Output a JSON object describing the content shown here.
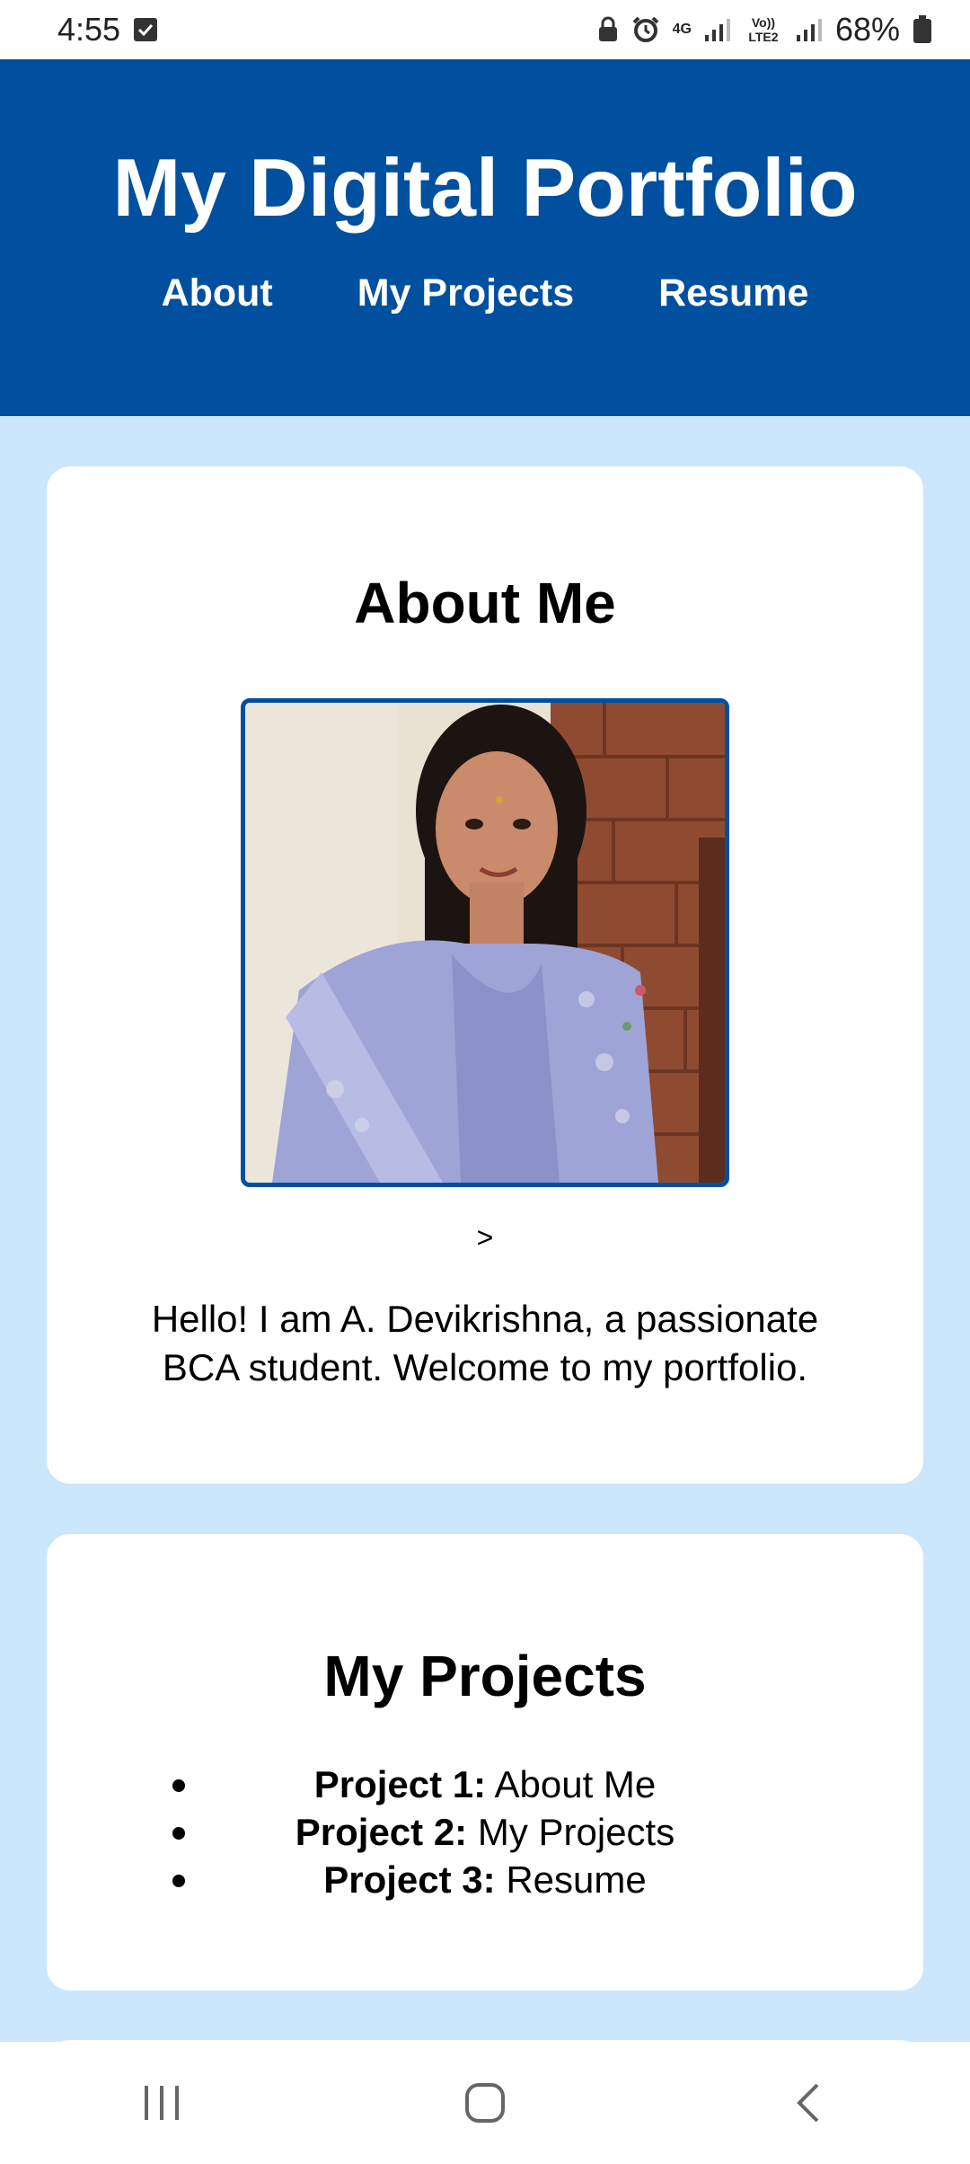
{
  "status_bar": {
    "time": "4:55",
    "network": "4G",
    "volte": "Vo)) LTE2",
    "battery": "68%",
    "icons": [
      "checkbox-notification-icon",
      "lock-icon",
      "alarm-icon",
      "signal-icon",
      "battery-icon"
    ]
  },
  "header": {
    "title": "My Digital Portfolio",
    "nav": [
      {
        "label": "About"
      },
      {
        "label": "My Projects"
      },
      {
        "label": "Resume"
      }
    ],
    "color": "#00509f"
  },
  "about": {
    "heading": "About Me",
    "photo_alt": "profile-photo",
    "stray_text": ">",
    "bio": "Hello! I am A. Devikrishna, a passionate BCA student. Welcome to my portfolio."
  },
  "projects": {
    "heading": "My Projects",
    "items": [
      {
        "label": "Project 1:",
        "name": "About Me"
      },
      {
        "label": "Project 2:",
        "name": "My Projects"
      },
      {
        "label": "Project 3:",
        "name": "Resume"
      }
    ]
  },
  "navigation_bar": {
    "buttons": [
      "recent-apps-icon",
      "home-icon",
      "back-icon"
    ]
  },
  "colors": {
    "background": "#cce6fb",
    "header": "#00509f",
    "card": "#ffffff"
  }
}
